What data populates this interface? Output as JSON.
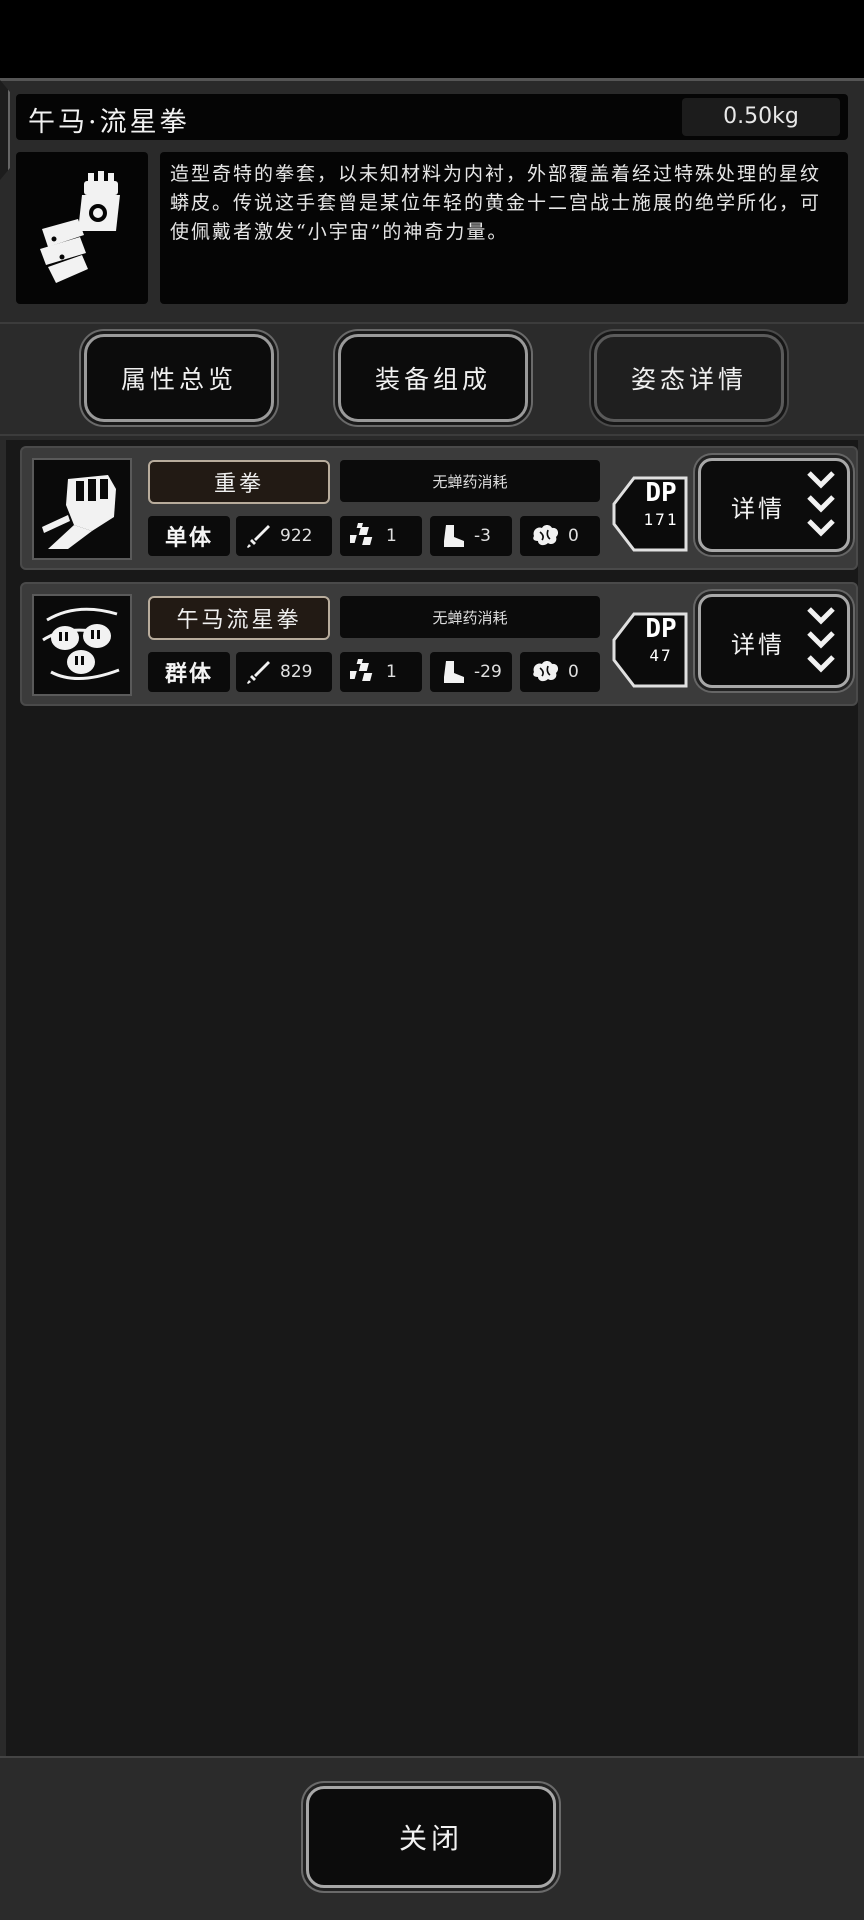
{
  "item": {
    "name": "午马·流星拳",
    "weight": "0.50kg",
    "description": "造型奇特的拳套，以未知材料为内衬，外部覆盖着经过特殊处理的星纹蟒皮。传说这手套曾是某位年轻的黄金十二宫战士施展的绝学所化，可使佩戴者激发“小宇宙”的神奇力量。",
    "icon": "gauntlet-icon"
  },
  "tabs": [
    {
      "label": "属性总览",
      "active": false
    },
    {
      "label": "装备组成",
      "active": false
    },
    {
      "label": "姿态详情",
      "active": true
    }
  ],
  "skills": [
    {
      "name": "重拳",
      "cost": "无蝉药消耗",
      "target": "单体",
      "attack": "922",
      "speed": "1",
      "move": "-3",
      "mind": "0",
      "dp_label": "DP",
      "dp_value": "171",
      "detail_label": "详情",
      "icon": "fist-punch-icon"
    },
    {
      "name": "午马流星拳",
      "cost": "无蝉药消耗",
      "target": "群体",
      "attack": "829",
      "speed": "1",
      "move": "-29",
      "mind": "0",
      "dp_label": "DP",
      "dp_value": "47",
      "detail_label": "详情",
      "icon": "meteor-fists-icon"
    }
  ],
  "footer": {
    "close_label": "关闭"
  },
  "colors": {
    "background": "#181818",
    "panel": "#2b2b2b",
    "row": "#3b3b3b",
    "accent_border": "#b8ac9c"
  }
}
